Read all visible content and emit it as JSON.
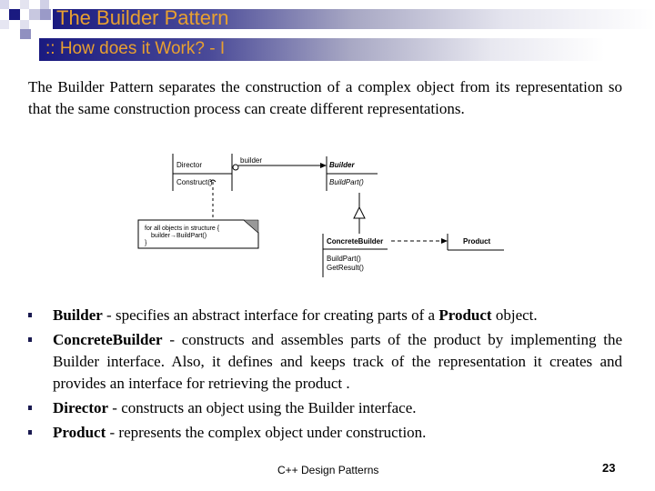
{
  "header": {
    "title": "The Builder Pattern",
    "subtitle": ":: How does it Work? - I"
  },
  "intro": "The Builder Pattern separates the construction of a complex object from its representation so that the same construction process can create different representations.",
  "diagram": {
    "director": {
      "name": "Director",
      "method": "Construct()"
    },
    "builder": {
      "name": "Builder",
      "method": "BuildPart()"
    },
    "association_label": "builder",
    "concrete_builder": {
      "name": "ConcreteBuilder",
      "methods": [
        "BuildPart()",
        "GetResult()"
      ]
    },
    "product": {
      "name": "Product"
    },
    "note": {
      "lines": [
        "for all objects in structure {",
        "builder→BuildPart()",
        "}"
      ]
    }
  },
  "bullets": [
    {
      "term": "Builder",
      "text_before": " - specifies an abstract interface for creating parts of a ",
      "bold_inline": "Product",
      "text_after": " object."
    },
    {
      "term": "ConcreteBuilder",
      "text_before": " - constructs and assembles parts of the product by implementing the Builder interface. Also, it defines and keeps track of the representation it creates and provides an interface for retrieving the product .",
      "bold_inline": "",
      "text_after": ""
    },
    {
      "term": "Director",
      "text_before": " - constructs an object using the Builder interface.",
      "bold_inline": "",
      "text_after": ""
    },
    {
      "term": "Product",
      "text_before": " - represents the complex object under construction.",
      "bold_inline": "",
      "text_after": ""
    }
  ],
  "footer": {
    "text": "C++ Design Patterns",
    "page_number": "23"
  },
  "colors": {
    "title_text": "#e8a030",
    "banner_dark": "#1a1a80",
    "bullet": "#1a1a50"
  }
}
